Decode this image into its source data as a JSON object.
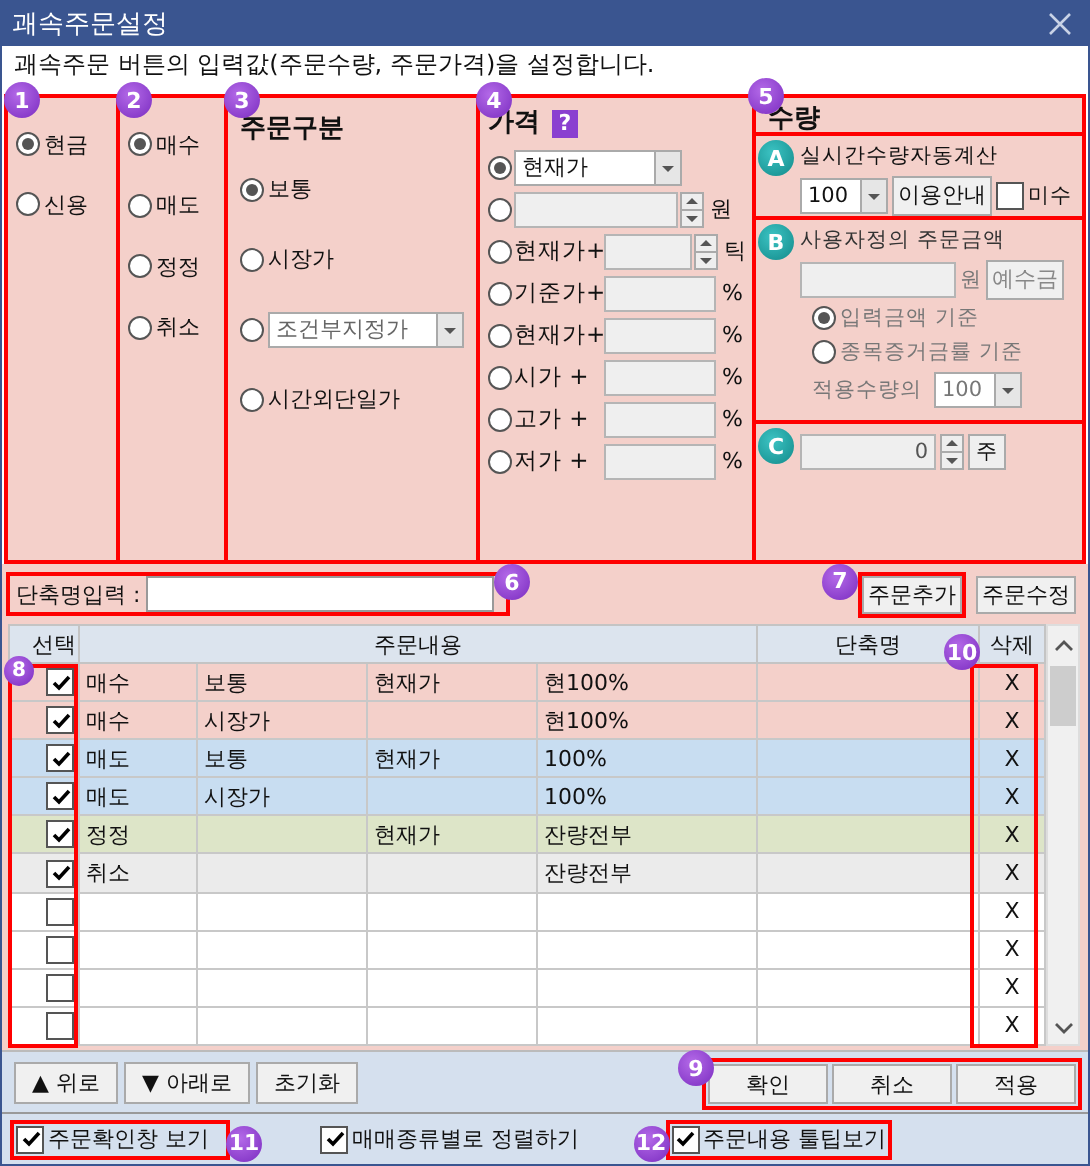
{
  "window": {
    "title": "괘속주문설정"
  },
  "description": "괘속주문 버튼의 입력값(주문수량, 주문가격)을 설정합니다.",
  "account_type": {
    "badge": "1",
    "options": [
      {
        "label": "현금",
        "selected": true
      },
      {
        "label": "신용",
        "selected": false
      }
    ]
  },
  "trade_type": {
    "badge": "2",
    "options": [
      {
        "label": "매수",
        "selected": true
      },
      {
        "label": "매도",
        "selected": false
      },
      {
        "label": "정정",
        "selected": false
      },
      {
        "label": "취소",
        "selected": false
      }
    ]
  },
  "order_type": {
    "badge": "3",
    "title": "주문구분",
    "options": [
      {
        "kind": "text",
        "label": "보통",
        "selected": true
      },
      {
        "kind": "text",
        "label": "시장가",
        "selected": false
      },
      {
        "kind": "dropdown",
        "value": "조건부지정가",
        "selected": false
      },
      {
        "kind": "text",
        "label": "시간외단일가",
        "selected": false
      }
    ]
  },
  "price": {
    "badge": "4",
    "title": "가격",
    "help": "?",
    "rows": [
      {
        "kind": "dropdown",
        "value": "현재가",
        "selected": true
      },
      {
        "kind": "spin",
        "unit": "원",
        "selected": false
      },
      {
        "kind": "spin",
        "label": "현재가+",
        "unit": "틱",
        "selected": false
      },
      {
        "kind": "field",
        "label": "기준가+",
        "unit": "%",
        "selected": false
      },
      {
        "kind": "field",
        "label": "현재가+",
        "unit": "%",
        "selected": false
      },
      {
        "kind": "field",
        "label": "시가 +",
        "unit": "%",
        "selected": false
      },
      {
        "kind": "field",
        "label": "고가 +",
        "unit": "%",
        "selected": false
      },
      {
        "kind": "field",
        "label": "저가 +",
        "unit": "%",
        "selected": false
      }
    ]
  },
  "quantity": {
    "badge": "5",
    "title": "수량",
    "auto_calc": {
      "badge": "A",
      "label": "실시간수량자동계산",
      "value": "100",
      "guide_button": "이용안내",
      "odd_lot": {
        "label": "미수",
        "checked": false
      }
    },
    "custom_amount": {
      "badge": "B",
      "label": "사용자정의 주문금액",
      "disabled": true,
      "unit": "원",
      "deposit_button": "예수금",
      "options": [
        {
          "label": "입력금액 기준",
          "selected": true
        },
        {
          "label": "종목증거금률 기준",
          "selected": false
        }
      ],
      "apply_label": "적용수량의",
      "apply_value": "100"
    },
    "fixed": {
      "badge": "C",
      "value": "0",
      "unit": "주"
    }
  },
  "short_name": {
    "badge": "6",
    "label": "단축명입력 :"
  },
  "order_buttons": [
    {
      "label": "주문추가",
      "badge": "7"
    },
    {
      "label": "주문수정"
    }
  ],
  "table": {
    "select_badge": "8",
    "delete_badge": "10",
    "columns": [
      "선택",
      "주문내용",
      "단축명",
      "삭제"
    ],
    "rows": [
      {
        "checked": true,
        "color": "#f4d0ca",
        "side": "매수",
        "type": "보통",
        "price": "현재가",
        "quantity": "현100%",
        "delete": "X"
      },
      {
        "checked": true,
        "color": "#f4d0ca",
        "side": "매수",
        "type": "시장가",
        "quantity": "현100%",
        "delete": "X"
      },
      {
        "checked": true,
        "color": "#c8ddf1",
        "side": "매도",
        "type": "보통",
        "price": "현재가",
        "quantity": "100%",
        "delete": "X"
      },
      {
        "checked": true,
        "color": "#c8ddf1",
        "side": "매도",
        "type": "시장가",
        "quantity": "100%",
        "delete": "X"
      },
      {
        "checked": true,
        "color": "#dde5c8",
        "side": "정정",
        "price": "현재가",
        "quantity": "잔량전부",
        "delete": "X"
      },
      {
        "checked": true,
        "color": "#ebebeb",
        "side": "취소",
        "quantity": "잔량전부",
        "delete": "X"
      },
      {
        "checked": false,
        "color": "#ffffff",
        "delete": "X"
      },
      {
        "checked": false,
        "color": "#ffffff",
        "delete": "X"
      },
      {
        "checked": false,
        "color": "#ffffff",
        "delete": "X"
      },
      {
        "checked": false,
        "color": "#ffffff",
        "delete": "X"
      }
    ]
  },
  "move_buttons": [
    "▲ 위로",
    "▼ 아래로",
    "초기화"
  ],
  "dialog_buttons": {
    "badge": "9",
    "labels": [
      "확인",
      "취소",
      "적용"
    ]
  },
  "options": [
    {
      "label": "주문확인창 보기",
      "checked": true,
      "badge": "11"
    },
    {
      "label": "매매종류별로 정렬하기",
      "checked": true
    },
    {
      "label": "주문내용 툴팁보기",
      "checked": true,
      "badge": "12"
    }
  ]
}
